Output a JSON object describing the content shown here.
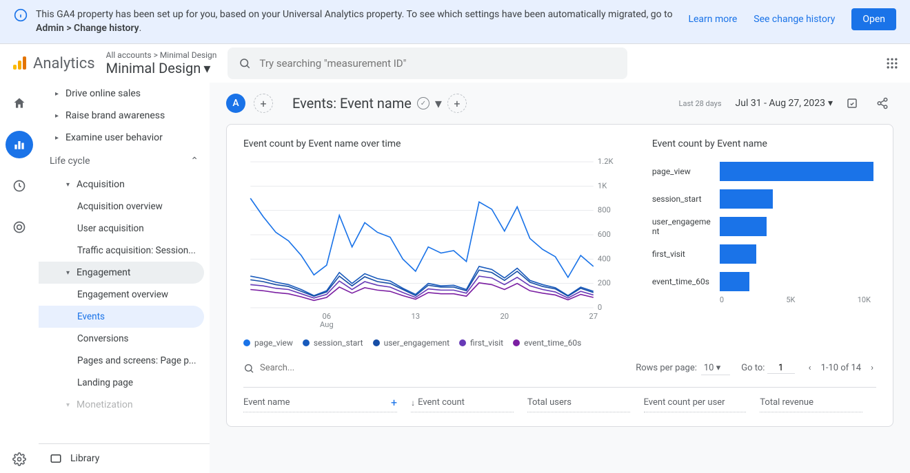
{
  "banner": {
    "text_a": "This GA4 property has been set up for you, based on your Universal Analytics property. To see which settings have been automatically migrated, go to ",
    "text_b": "Admin > Change history",
    "learn_more": "Learn more",
    "see_history": "See change history",
    "open": "Open"
  },
  "header": {
    "product": "Analytics",
    "crumb_top": "All accounts > Minimal Design",
    "crumb_main": "Minimal Design",
    "search_placeholder": "Try searching \"measurement ID\""
  },
  "sidebar": {
    "top_items": [
      "Drive online sales",
      "Raise brand awareness",
      "Examine user behavior"
    ],
    "section": "Life cycle",
    "acquisition": {
      "label": "Acquisition",
      "items": [
        "Acquisition overview",
        "User acquisition",
        "Traffic acquisition: Session..."
      ]
    },
    "engagement": {
      "label": "Engagement",
      "items": [
        "Engagement overview",
        "Events",
        "Conversions",
        "Pages and screens: Page p...",
        "Landing page"
      ]
    },
    "monetization": "Monetization",
    "library": "Library"
  },
  "main": {
    "chip": "A",
    "title": "Events: Event name",
    "date_label": "Last 28 days",
    "date_range": "Jul 31 - Aug 27, 2023"
  },
  "chart_left_title": "Event count by Event name over time",
  "chart_right_title": "Event count by Event name",
  "chart_data": [
    {
      "type": "line",
      "title": "Event count by Event name over time",
      "xlabel": "Aug",
      "ylabel": "",
      "ylim": [
        0,
        1200
      ],
      "x": [
        "31",
        "01",
        "02",
        "03",
        "04",
        "05",
        "06",
        "07",
        "08",
        "09",
        "10",
        "11",
        "12",
        "13",
        "14",
        "15",
        "16",
        "17",
        "18",
        "19",
        "20",
        "21",
        "22",
        "23",
        "24",
        "25",
        "26",
        "27"
      ],
      "x_ticks": [
        "06",
        "13",
        "20",
        "27"
      ],
      "y_ticks": [
        "0",
        "200",
        "400",
        "600",
        "800",
        "1K",
        "1.2K"
      ],
      "series": [
        {
          "name": "page_view",
          "color": "#1a73e8",
          "values": [
            900,
            750,
            620,
            550,
            430,
            270,
            350,
            760,
            500,
            700,
            620,
            580,
            400,
            300,
            500,
            450,
            470,
            380,
            870,
            810,
            630,
            830,
            570,
            480,
            420,
            250,
            430,
            340
          ]
        },
        {
          "name": "session_start",
          "color": "#185abc",
          "values": [
            260,
            240,
            210,
            190,
            150,
            100,
            140,
            290,
            200,
            280,
            240,
            220,
            160,
            110,
            200,
            180,
            185,
            150,
            340,
            315,
            245,
            325,
            225,
            190,
            165,
            100,
            170,
            135
          ]
        },
        {
          "name": "user_engagement",
          "color": "#174ea6",
          "values": [
            230,
            215,
            190,
            175,
            135,
            95,
            130,
            260,
            180,
            255,
            215,
            200,
            150,
            100,
            185,
            170,
            170,
            140,
            310,
            290,
            225,
            300,
            210,
            175,
            155,
            95,
            160,
            125
          ]
        },
        {
          "name": "first_visit",
          "color": "#673ab7",
          "values": [
            190,
            180,
            160,
            150,
            115,
            80,
            110,
            220,
            150,
            215,
            185,
            170,
            125,
            85,
            155,
            145,
            145,
            120,
            260,
            245,
            190,
            250,
            180,
            150,
            130,
            80,
            135,
            105
          ]
        },
        {
          "name": "event_time_60s",
          "color": "#7b1fa2",
          "values": [
            150,
            140,
            125,
            115,
            90,
            60,
            85,
            170,
            120,
            165,
            145,
            135,
            100,
            70,
            125,
            115,
            115,
            95,
            205,
            190,
            150,
            200,
            140,
            120,
            105,
            65,
            110,
            85
          ]
        }
      ]
    },
    {
      "type": "bar",
      "orientation": "horizontal",
      "title": "Event count by Event name",
      "xlim": [
        0,
        12000
      ],
      "x_ticks": [
        "0",
        "5K",
        "10K"
      ],
      "categories": [
        "page_view",
        "session_start",
        "user_engagement",
        "first_visit",
        "event_time_60s"
      ],
      "values": [
        11800,
        4100,
        3600,
        2800,
        2300
      ]
    }
  ],
  "table": {
    "search_placeholder": "Search...",
    "rows_per_page_label": "Rows per page:",
    "rows_per_page": "10",
    "goto_label": "Go to:",
    "goto": "1",
    "range": "1-10 of 14",
    "columns": [
      "Event name",
      "Event count",
      "Total users",
      "Event count per user",
      "Total revenue"
    ]
  }
}
